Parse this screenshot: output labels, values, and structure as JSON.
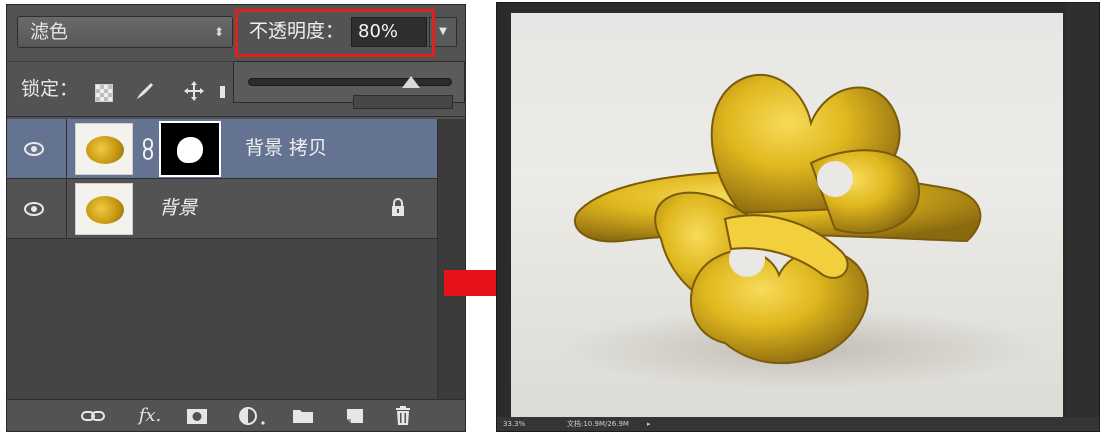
{
  "layers_panel": {
    "blend_mode": "滤色",
    "blend_mode_arrows": "⬍",
    "opacity_label": "不透明度：",
    "opacity_value": "80%",
    "opacity_dropdown_icon": "chevron-down-icon",
    "opacity_slider_level": 0.8,
    "lock_label": "锁定：",
    "lock_icons": [
      "lock-transparent-pixels-icon",
      "brush-icon",
      "move-icon"
    ],
    "layers": [
      {
        "name": "背景 拷贝",
        "visible": true,
        "selected": true,
        "has_mask": true,
        "linked": true
      },
      {
        "name": "背景",
        "visible": true,
        "selected": false,
        "locked": true
      }
    ],
    "bottom_icons": [
      "link-icon",
      "fx-icon",
      "mask-icon",
      "adjustment-icon",
      "folder-icon",
      "new-layer-icon",
      "trash-icon"
    ],
    "fx_label": "fx."
  },
  "canvas": {
    "zoom_text": "33.3%",
    "doc_text": "文档:10.9M/26.9M"
  },
  "colors": {
    "highlight": "#e0201a",
    "arrow": "#e8121a",
    "selected_layer": "#637391",
    "panel_bg": "#535353"
  }
}
